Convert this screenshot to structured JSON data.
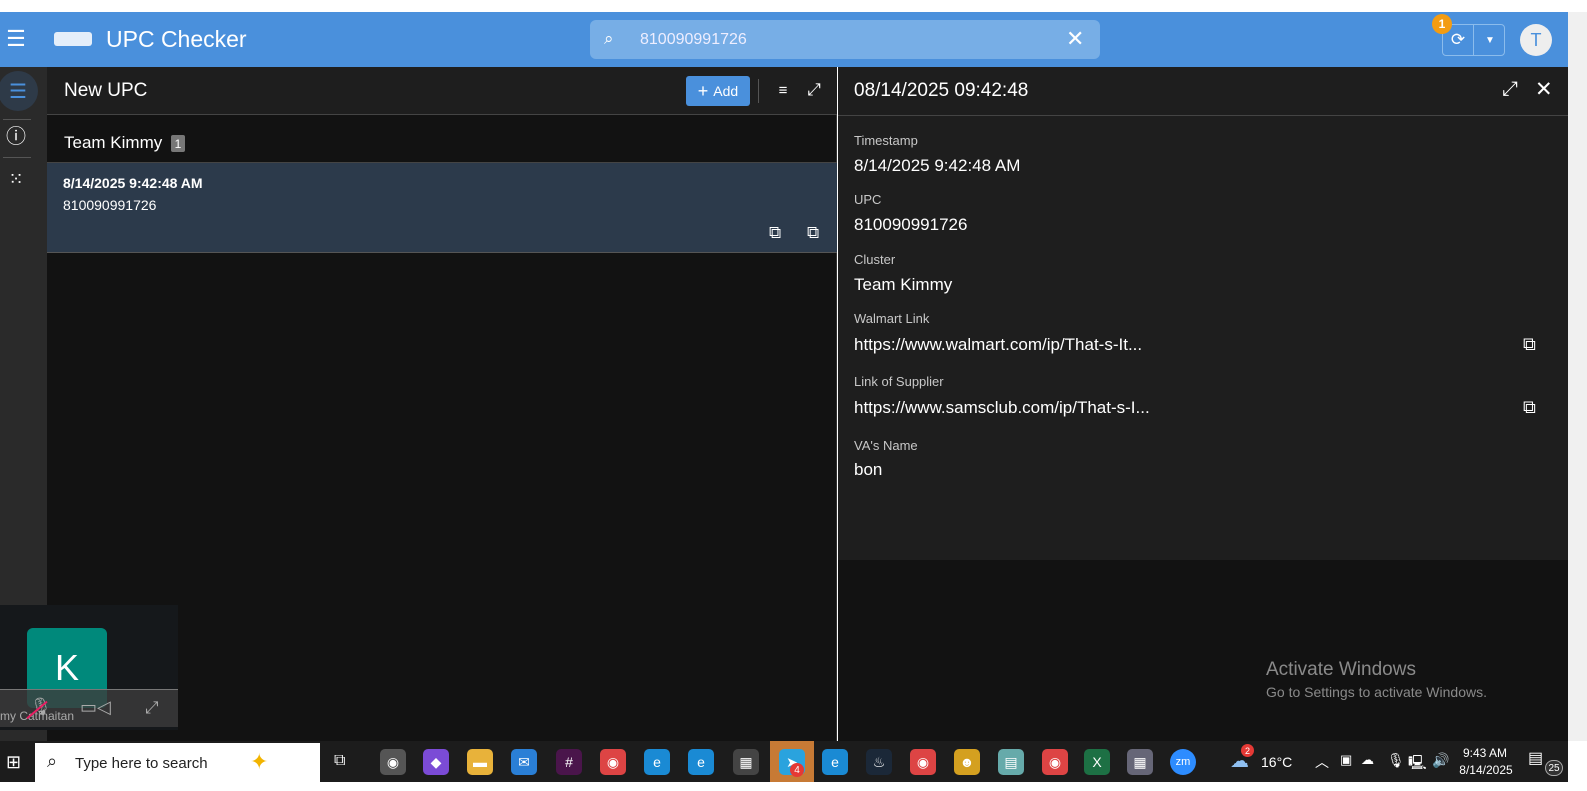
{
  "header": {
    "title": "UPC Checker",
    "search_value": "810090991726",
    "sync_badge": "1",
    "avatar": "T"
  },
  "list": {
    "title": "New UPC",
    "add_label": "Add",
    "group": "Team Kimmy",
    "group_count": "1",
    "items": [
      {
        "timestamp": "8/14/2025 9:42:48 AM",
        "upc": "810090991726"
      }
    ]
  },
  "detail": {
    "title": "08/14/2025 09:42:48",
    "fields": [
      {
        "label": "Timestamp",
        "value": "8/14/2025 9:42:48 AM"
      },
      {
        "label": "UPC",
        "value": "810090991726"
      },
      {
        "label": "Cluster",
        "value": "Team Kimmy"
      },
      {
        "label": "Walmart Link",
        "value": "https://www.walmart.com/ip/That-s-It..."
      },
      {
        "label": "Link of Supplier",
        "value": "https://www.samsclub.com/ip/That-s-I..."
      },
      {
        "label": "VA's Name",
        "value": "bon"
      }
    ]
  },
  "watermark": {
    "title": "Activate Windows",
    "sub": "Go to Settings to activate Windows."
  },
  "call": {
    "initial": "K",
    "name": "my Catmaitan"
  },
  "taskbar": {
    "search": "Type here to search",
    "weather": "16°C",
    "weather_badge": "2",
    "time": "9:43 AM",
    "date": "8/14/2025",
    "notif": "25",
    "telegram_badge": "4"
  }
}
